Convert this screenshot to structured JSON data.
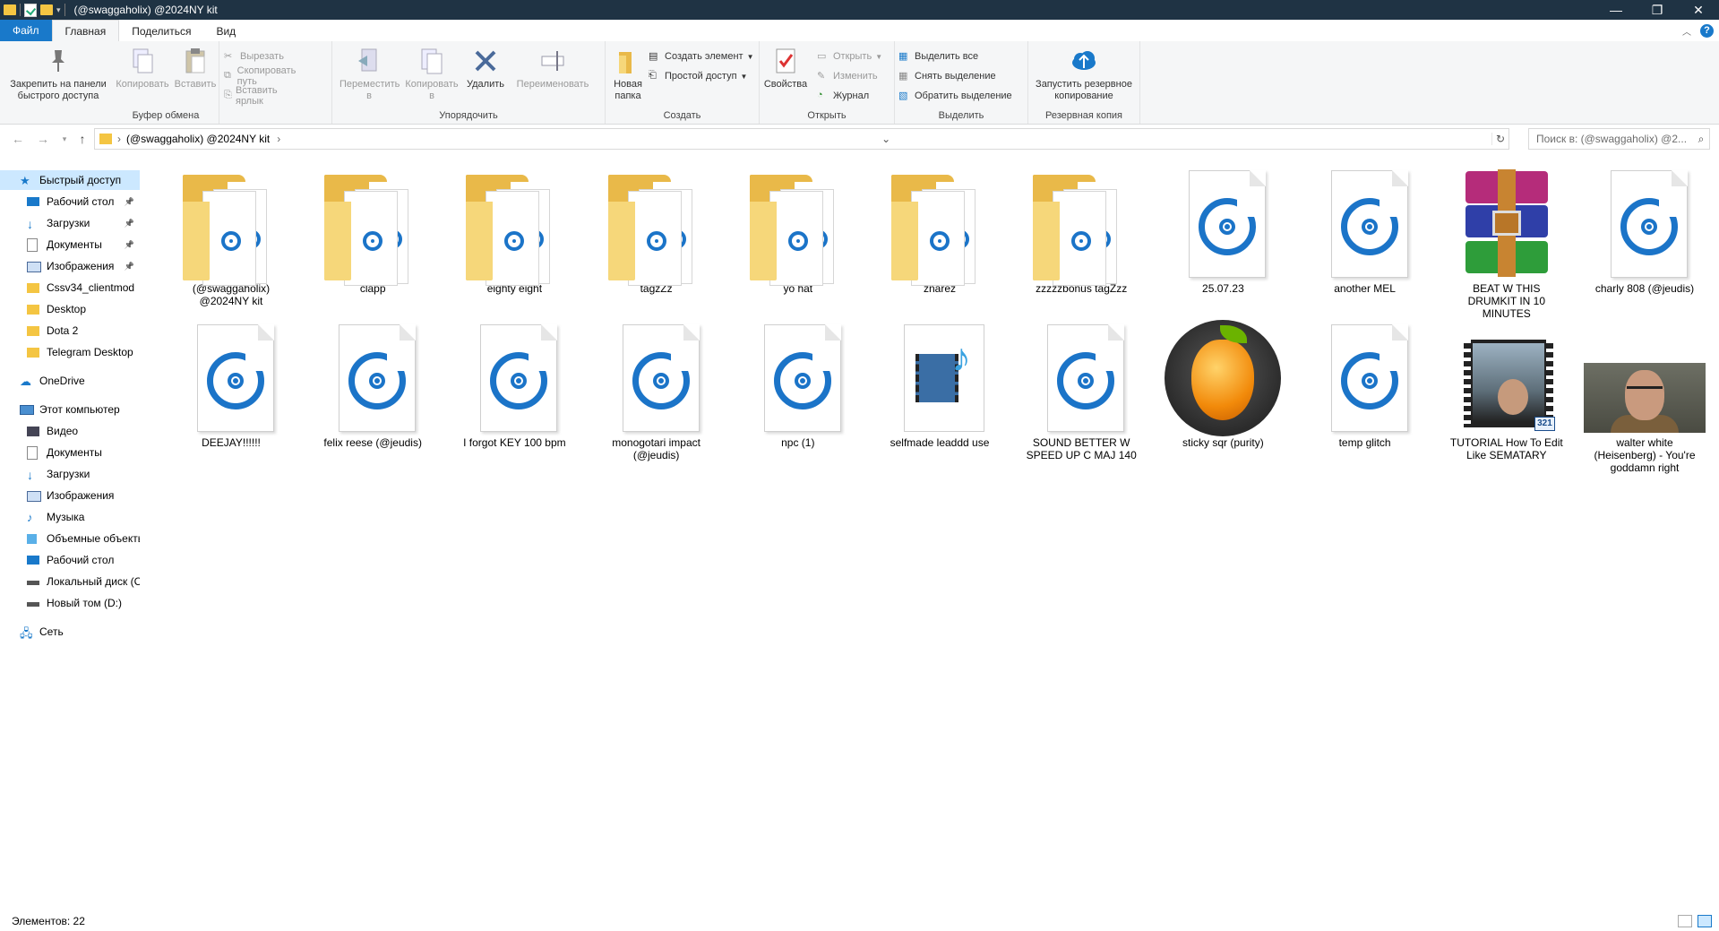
{
  "window": {
    "title": "(@swaggaholix) @2024NY kit",
    "minimize": "—",
    "maximize": "❐",
    "close": "✕"
  },
  "tabs": {
    "file": "Файл",
    "home": "Главная",
    "share": "Поделиться",
    "view": "Вид",
    "help": "?"
  },
  "ribbon": {
    "clipboard": {
      "label": "Буфер обмена",
      "pin": "Закрепить на панели быстрого доступа",
      "copy": "Копировать",
      "paste": "Вставить",
      "cut": "Вырезать",
      "copy_path": "Скопировать путь",
      "paste_shortcut": "Вставить ярлык"
    },
    "organize": {
      "label": "Упорядочить",
      "move": "Переместить в",
      "copy_to": "Копировать в",
      "delete": "Удалить",
      "rename": "Переименовать"
    },
    "create": {
      "label": "Создать",
      "new_folder": "Новая папка",
      "new_item": "Создать элемент",
      "easy_access": "Простой доступ"
    },
    "open": {
      "label": "Открыть",
      "properties": "Свойства",
      "open": "Открыть",
      "edit": "Изменить",
      "history": "Журнал"
    },
    "select": {
      "label": "Выделить",
      "select_all": "Выделить все",
      "select_none": "Снять выделение",
      "invert": "Обратить выделение"
    },
    "backup": {
      "label": "Резервная копия",
      "start": "Запустить резервное копирование"
    }
  },
  "address": {
    "path": "(@swaggaholix) @2024NY kit",
    "search_placeholder": "Поиск в: (@swaggaholix) @2..."
  },
  "sidebar": {
    "quick_access": "Быстрый доступ",
    "quick": [
      "Рабочий стол",
      "Загрузки",
      "Документы",
      "Изображения",
      "Cssv34_clientmod",
      "Desktop",
      "Dota 2",
      "Telegram Desktop"
    ],
    "onedrive": "OneDrive",
    "this_pc": "Этот компьютер",
    "pc": [
      "Видео",
      "Документы",
      "Загрузки",
      "Изображения",
      "Музыка",
      "Объемные объекты",
      "Рабочий стол",
      "Локальный диск (C:)",
      "Новый том (D:)"
    ],
    "network": "Сеть"
  },
  "files": [
    {
      "name": "(@swaggaholix) @2024NY kit",
      "kind": "folder"
    },
    {
      "name": "clapp",
      "kind": "folder"
    },
    {
      "name": "eighty eight",
      "kind": "folder"
    },
    {
      "name": "tagzZz",
      "kind": "folder"
    },
    {
      "name": "yo hat",
      "kind": "folder"
    },
    {
      "name": "znarez",
      "kind": "folder"
    },
    {
      "name": "zzzzzbonus tagZzz",
      "kind": "folder"
    },
    {
      "name": "25.07.23",
      "kind": "audio"
    },
    {
      "name": "another MEL",
      "kind": "audio"
    },
    {
      "name": "BEAT W THIS DRUMKIT IN 10 MINUTES",
      "kind": "winrar"
    },
    {
      "name": "charly 808 (@jeudis)",
      "kind": "audio"
    },
    {
      "name": "DEEJAY!!!!!!",
      "kind": "audio"
    },
    {
      "name": "felix reese (@jeudis)",
      "kind": "audio"
    },
    {
      "name": "I forgot KEY 100 bpm",
      "kind": "audio"
    },
    {
      "name": "monogotari impact (@jeudis)",
      "kind": "audio"
    },
    {
      "name": "npc (1)",
      "kind": "audio"
    },
    {
      "name": "selfmade leaddd use",
      "kind": "media"
    },
    {
      "name": "SOUND BETTER W SPEED UP C MAJ 140",
      "kind": "audio"
    },
    {
      "name": "sticky sqr (purity)",
      "kind": "flstudio"
    },
    {
      "name": "temp glitch",
      "kind": "audio"
    },
    {
      "name": "TUTORIAL How To Edit Like SEMATARY",
      "kind": "video"
    },
    {
      "name": "walter white (Heisenberg) - You're goddamn right",
      "kind": "image"
    }
  ],
  "status": {
    "count": "Элементов: 22"
  }
}
